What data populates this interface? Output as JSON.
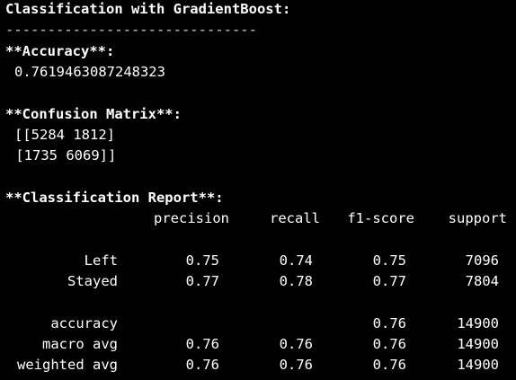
{
  "output": {
    "title": "Classification with GradientBoost:",
    "separator": "------------------------------",
    "accuracy_heading": "**Accuracy**:",
    "accuracy_value": "0.7619463087248323",
    "cm_heading": "**Confusion Matrix**:",
    "cm_row1": "[[5284 1812]",
    "cm_row2": " [1735 6069]]",
    "report_heading": "**Classification Report**:",
    "report": {
      "headers": [
        "precision",
        "recall",
        "f1-score",
        "support"
      ],
      "rows": [
        {
          "label": "Left",
          "precision": "0.75",
          "recall": "0.74",
          "f1": "0.75",
          "support": "7096"
        },
        {
          "label": "Stayed",
          "precision": "0.77",
          "recall": "0.78",
          "f1": "0.77",
          "support": "7804"
        },
        {
          "label": "accuracy",
          "precision": "",
          "recall": "",
          "f1": "0.76",
          "support": "14900"
        },
        {
          "label": "macro avg",
          "precision": "0.76",
          "recall": "0.76",
          "f1": "0.76",
          "support": "14900"
        },
        {
          "label": "weighted avg",
          "precision": "0.76",
          "recall": "0.76",
          "f1": "0.76",
          "support": "14900"
        }
      ]
    }
  }
}
